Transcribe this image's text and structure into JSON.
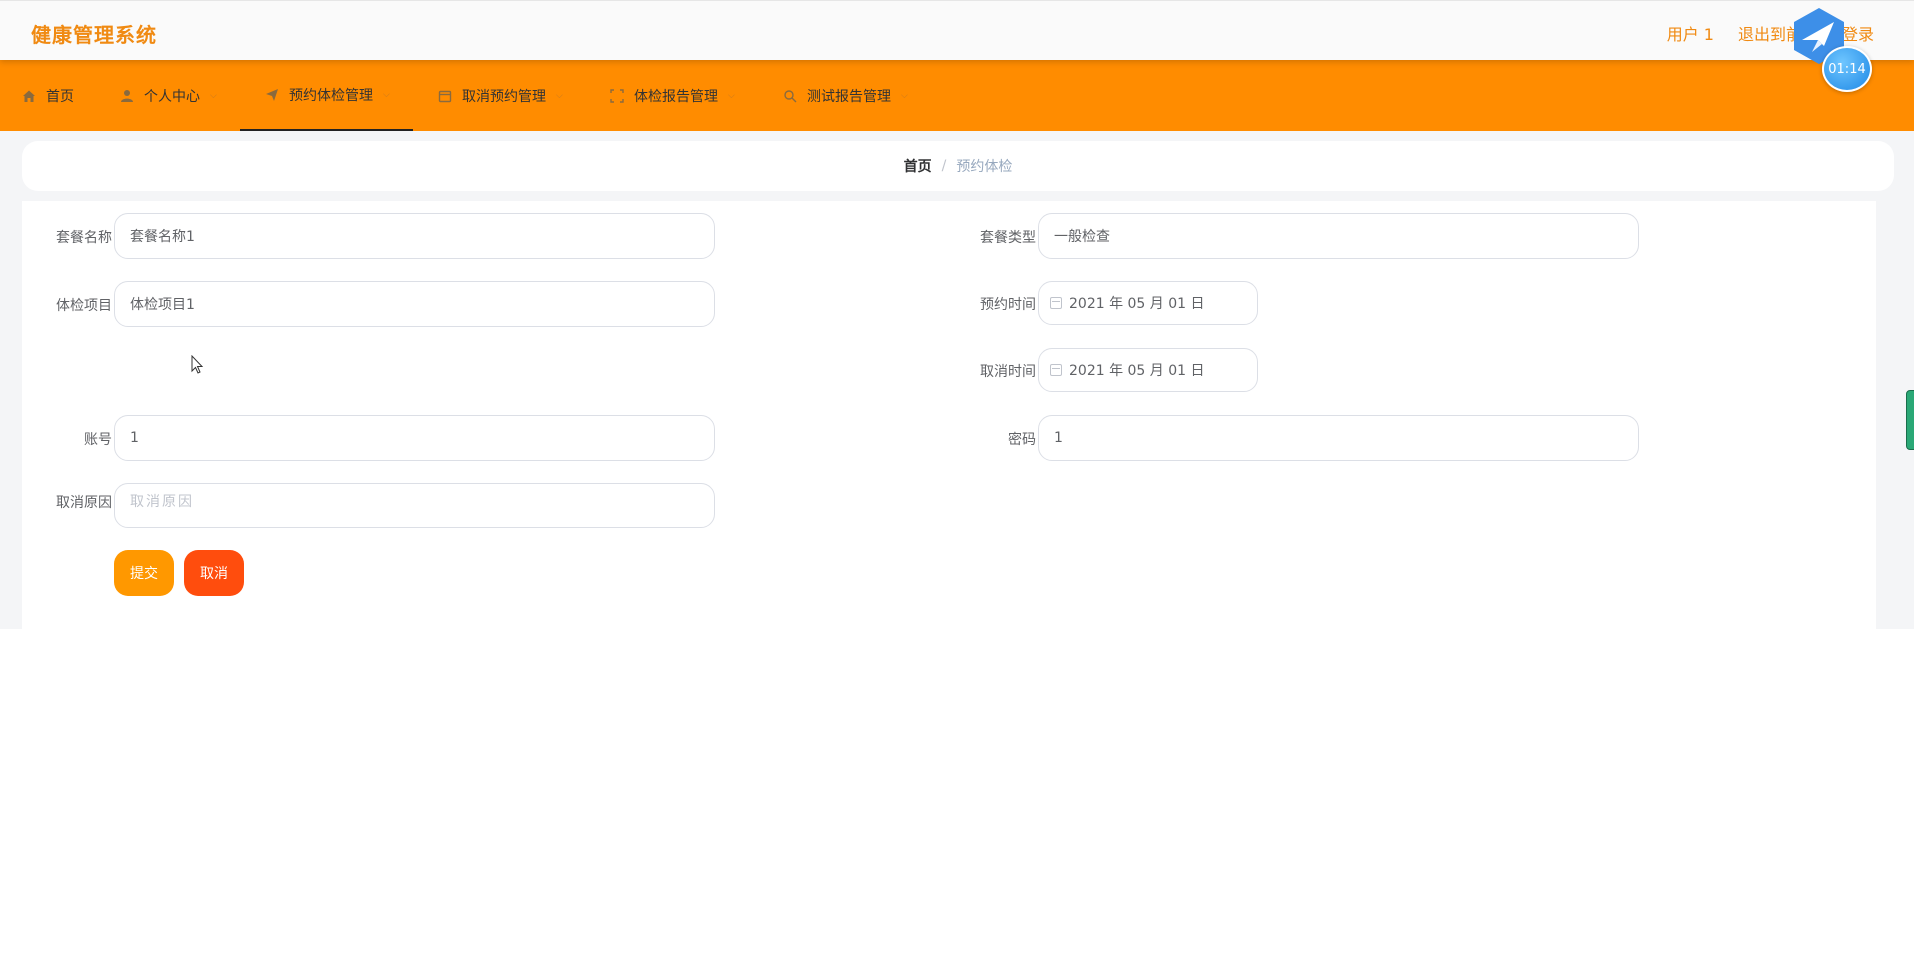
{
  "app": {
    "title": "健康管理系统"
  },
  "top_right": {
    "user": "用户 1",
    "exit_front": "退出到前台",
    "logout": "登录"
  },
  "timer": {
    "value": "01:14"
  },
  "nav": [
    {
      "label": "首页",
      "icon": "home-icon"
    },
    {
      "label": "个人中心",
      "icon": "user-icon"
    },
    {
      "label": "预约体检管理",
      "icon": "send-icon",
      "active": true
    },
    {
      "label": "取消预约管理",
      "icon": "calendar-icon"
    },
    {
      "label": "体检报告管理",
      "icon": "frame-icon"
    },
    {
      "label": "测试报告管理",
      "icon": "search-icon"
    }
  ],
  "breadcrumb": {
    "home": "首页",
    "separator": "/",
    "current": "预约体检"
  },
  "form": {
    "package_name": {
      "label": "套餐名称",
      "value": "套餐名称1"
    },
    "package_type": {
      "label": "套餐类型",
      "value": "一般检查"
    },
    "exam_items": {
      "label": "体检项目",
      "value": "体检项目1"
    },
    "appointment_time": {
      "label": "预约时间",
      "value": "2021 年 05 月 01 日"
    },
    "cancel_time": {
      "label": "取消时间",
      "value": "2021 年 05 月 01 日"
    },
    "account": {
      "label": "账号",
      "value": "1"
    },
    "password": {
      "label": "密码",
      "value": "1"
    },
    "cancel_reason": {
      "label": "取消原因",
      "placeholder": "取消原因"
    },
    "submit_label": "提交",
    "cancel_label": "取消"
  },
  "colors": {
    "accent": "#ff8c00",
    "title": "#f08a12",
    "cancel_button": "#ff4d0d",
    "submit_button": "#ff9800"
  }
}
